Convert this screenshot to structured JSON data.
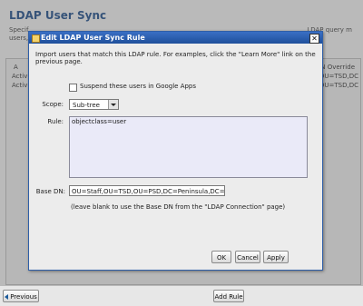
{
  "page": {
    "title": "LDAP User Sync",
    "description_left": "Specif",
    "description_right": "LDAP query m",
    "description_line2": "users,",
    "table": {
      "header_left": "A",
      "header_right": "DN Override",
      "rows": [
        {
          "left": "Activ",
          "right": "D,OU=TSD,DC"
        },
        {
          "left": "Activ",
          "right": "D,OU=TSD,DC"
        }
      ]
    }
  },
  "dialog": {
    "title": "Edit LDAP User Sync Rule",
    "close_glyph": "✕",
    "intro": "Import users that match this LDAP rule.  For examples, click the \"Learn More\" link on the previous page.",
    "suspend_label": "Suspend these users in Google Apps",
    "scope_label": "Scope:",
    "scope_value": "Sub-tree",
    "rule_label": "Rule:",
    "rule_value": "objectclass=user",
    "base_dn_label": "Base DN:",
    "base_dn_value": "OU=Staff,OU=TSD,OU=PSD,DC=Peninsula,DC=wednet",
    "hint": "(leave blank to use the Base DN from the \"LDAP Connection\" page)",
    "ok": "OK",
    "cancel": "Cancel",
    "apply": "Apply"
  },
  "toolbar": {
    "previous": "Previous",
    "add_rule": "Add Rule"
  }
}
